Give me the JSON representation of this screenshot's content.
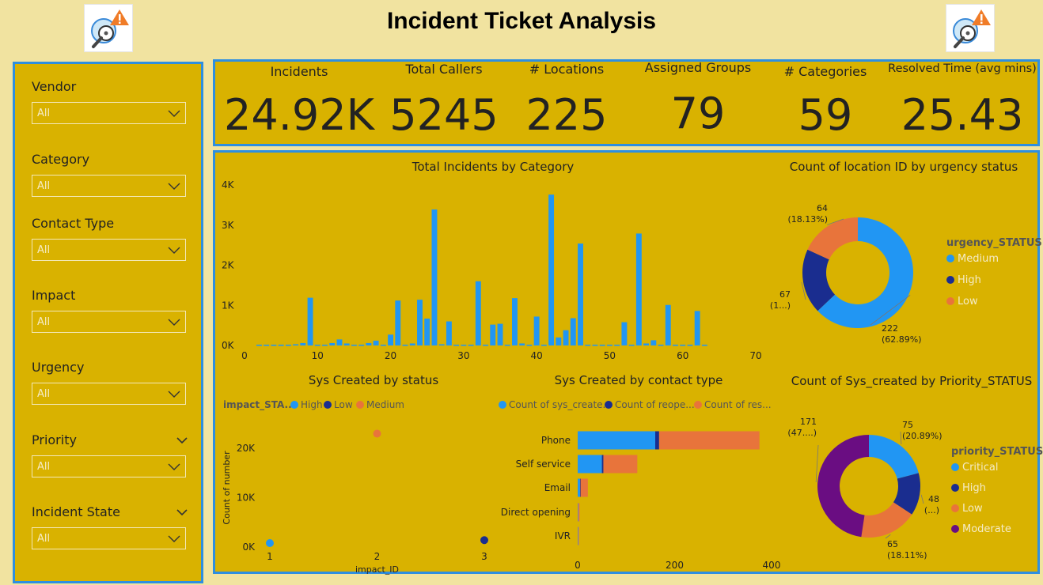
{
  "header": {
    "title": "Incident Ticket Analysis",
    "logo_icon": "incident-search-icon"
  },
  "filters": [
    {
      "label": "Vendor",
      "value": "All",
      "header_chevron": false
    },
    {
      "label": "Category",
      "value": "All",
      "header_chevron": false
    },
    {
      "label": "Contact Type",
      "value": "All",
      "header_chevron": false
    },
    {
      "label": "Impact",
      "value": "All",
      "header_chevron": false
    },
    {
      "label": "Urgency",
      "value": "All",
      "header_chevron": false
    },
    {
      "label": "Priority",
      "value": "All",
      "header_chevron": true
    },
    {
      "label": "Incident State",
      "value": "All",
      "header_chevron": true
    }
  ],
  "kpis": [
    {
      "label": "Incidents",
      "value": "24.92K"
    },
    {
      "label": "Total Callers",
      "value": "5245"
    },
    {
      "label": "# Locations",
      "value": "225"
    },
    {
      "label": "Assigned Groups",
      "value": "79"
    },
    {
      "label": "# Categories",
      "value": "59"
    },
    {
      "label": "Resolved Time (avg mins)",
      "value": "25.43"
    }
  ],
  "colors": {
    "background": "#f1e3a0",
    "panel": "#d9b200",
    "panel_border": "#2e8fe0",
    "blue": "#2196f3",
    "navy": "#1a2d8f",
    "orange": "#e8743b",
    "purple": "#6a0d82"
  },
  "chart_data": [
    {
      "id": "category",
      "type": "bar",
      "title": "Total Incidents by Category",
      "xlim": [
        0,
        70
      ],
      "ylim": [
        0,
        4000
      ],
      "x_ticks": [
        "0",
        "10",
        "20",
        "30",
        "40",
        "50",
        "60",
        "70"
      ],
      "y_ticks": [
        "0K",
        "1K",
        "2K",
        "3K",
        "4K"
      ],
      "x": [
        2,
        3,
        4,
        5,
        6,
        7,
        8,
        9,
        10,
        11,
        12,
        13,
        14,
        15,
        16,
        17,
        18,
        19,
        20,
        21,
        22,
        23,
        24,
        25,
        26,
        27,
        28,
        29,
        30,
        31,
        32,
        33,
        34,
        35,
        36,
        37,
        38,
        39,
        40,
        41,
        42,
        43,
        44,
        45,
        46,
        47,
        48,
        49,
        50,
        51,
        52,
        53,
        54,
        55,
        56,
        57,
        58,
        59,
        60,
        61,
        62,
        63
      ],
      "values": [
        20,
        20,
        20,
        20,
        20,
        30,
        60,
        1190,
        20,
        20,
        60,
        150,
        50,
        20,
        20,
        60,
        120,
        20,
        270,
        1120,
        20,
        50,
        1140,
        670,
        3390,
        30,
        600,
        20,
        20,
        20,
        1600,
        20,
        520,
        540,
        20,
        1180,
        50,
        20,
        720,
        20,
        3760,
        200,
        380,
        680,
        2540,
        20,
        20,
        20,
        20,
        20,
        580,
        20,
        2790,
        50,
        130,
        20,
        1010,
        20,
        20,
        20,
        860,
        20
      ],
      "color": "#2196f3"
    },
    {
      "id": "urgency",
      "type": "pie",
      "donut": true,
      "title": "Count of location ID by urgency status",
      "legend_title": "urgency_STATUS",
      "legend_position": "right",
      "categories": [
        "Medium",
        "High",
        "Low"
      ],
      "values": [
        222,
        67,
        64
      ],
      "colors": [
        "#2196f3",
        "#1a2d8f",
        "#e8743b"
      ],
      "labels": [
        [
          "222",
          "(62.89%)"
        ],
        [
          "67",
          "(1...)"
        ],
        [
          "64",
          "(18.13%)"
        ]
      ]
    },
    {
      "id": "impact",
      "type": "scatter",
      "title": "Sys Created by status",
      "legend_title": "impact_STA...",
      "legend_position": "top",
      "xlabel": "impact_ID",
      "ylabel": "Count of number",
      "xlim": [
        1,
        3
      ],
      "ylim": [
        0,
        25000
      ],
      "x_ticks": [
        "1",
        "2",
        "3"
      ],
      "y_ticks": [
        "0K",
        "10K",
        "20K"
      ],
      "series": [
        {
          "name": "High",
          "color": "#2196f3",
          "points": [
            [
              1,
              800
            ]
          ]
        },
        {
          "name": "Low",
          "color": "#1a2d8f",
          "points": [
            [
              3,
              1400
            ]
          ]
        },
        {
          "name": "Medium",
          "color": "#e8743b",
          "points": [
            [
              2,
              23000
            ]
          ]
        }
      ]
    },
    {
      "id": "contact",
      "type": "bar",
      "orientation": "horizontal",
      "stacked": true,
      "title": "Sys Created by contact type",
      "legend_position": "top",
      "categories": [
        "Phone",
        "Self service",
        "Email",
        "Direct opening",
        "IVR"
      ],
      "xlim": [
        0,
        400
      ],
      "x_ticks": [
        "0",
        "200",
        "400"
      ],
      "series": [
        {
          "name": "Count of sys_create...",
          "color": "#2196f3",
          "values": [
            160,
            50,
            5,
            1,
            1
          ]
        },
        {
          "name": "Count of reope...",
          "color": "#1a2d8f",
          "values": [
            8,
            3,
            1,
            0,
            0
          ]
        },
        {
          "name": "Count of res...",
          "color": "#e8743b",
          "values": [
            207,
            70,
            15,
            3,
            1
          ]
        }
      ]
    },
    {
      "id": "priority",
      "type": "pie",
      "donut": true,
      "title": "Count of Sys_created by Priority_STATUS",
      "legend_title": "priority_STATUS",
      "legend_position": "right",
      "categories": [
        "Critical",
        "High",
        "Low",
        "Moderate"
      ],
      "values": [
        75,
        48,
        65,
        171
      ],
      "colors": [
        "#2196f3",
        "#1a2d8f",
        "#e8743b",
        "#6a0d82"
      ],
      "labels": [
        [
          "75",
          "(20.89%)"
        ],
        [
          "48",
          "(...)"
        ],
        [
          "65",
          "(18.11%)"
        ],
        [
          "171",
          "(47....)"
        ]
      ]
    }
  ]
}
